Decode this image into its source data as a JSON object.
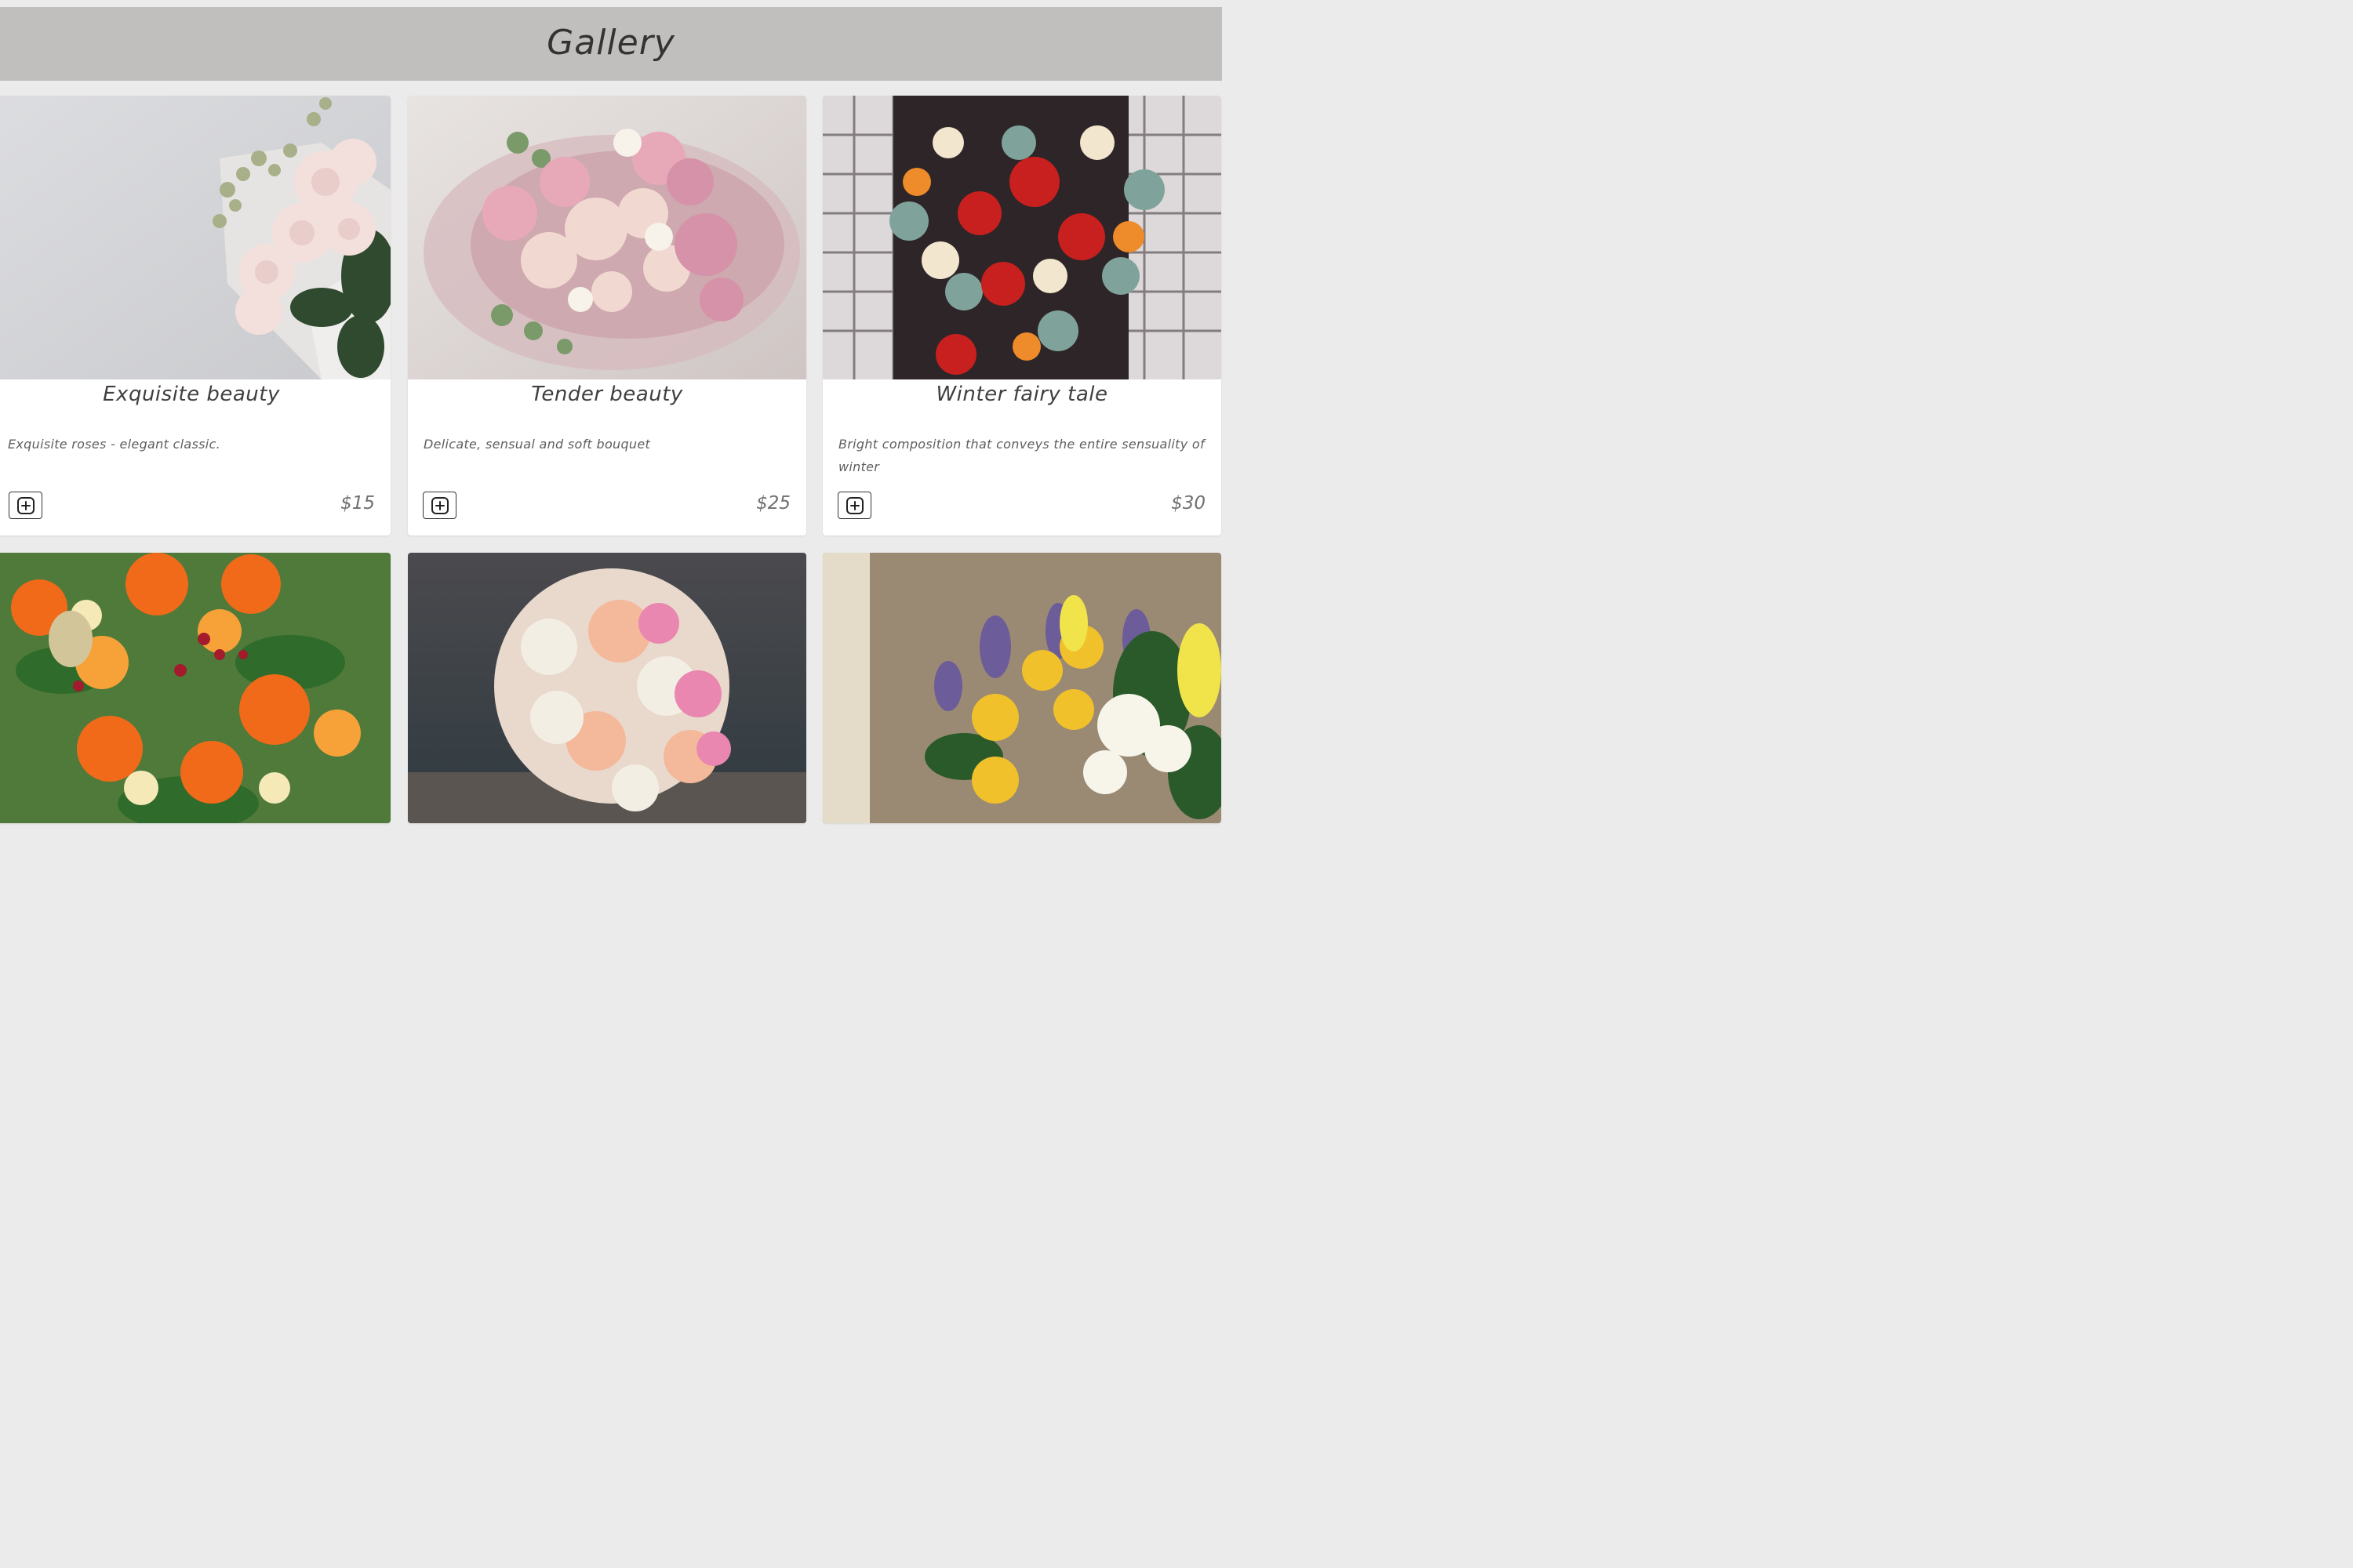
{
  "header": {
    "title": "Gallery"
  },
  "cards": [
    {
      "title": "Exquisite beauty",
      "description": "Exquisite roses - elegant classic.",
      "price": "$15",
      "add_icon": "plus-square-icon"
    },
    {
      "title": "Tender beauty",
      "description": "Delicate, sensual and soft bouquet",
      "price": "$25",
      "add_icon": "plus-square-icon"
    },
    {
      "title": "Winter fairy tale",
      "description": "Bright composition that conveys the entire sensuality of winter",
      "price": "$30",
      "add_icon": "plus-square-icon"
    },
    {
      "photo": "orange-roses-bouquet"
    },
    {
      "photo": "pastel-rose-bouquet"
    },
    {
      "photo": "yellow-tulip-bouquet"
    }
  ],
  "colors": {
    "page_bg": "#ebebeb",
    "header_bg": "#c0bfbd",
    "card_bg": "#ffffff"
  }
}
